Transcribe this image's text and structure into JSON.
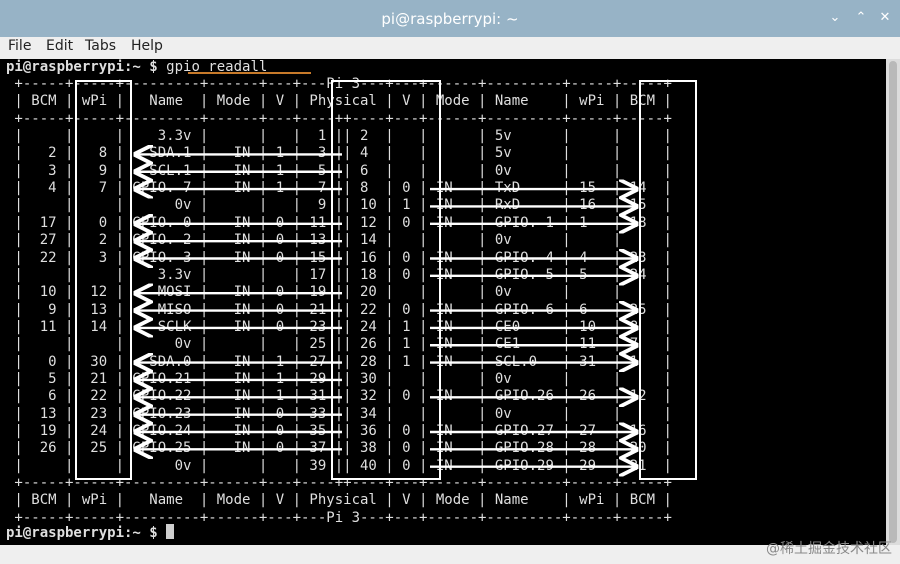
{
  "window": {
    "title": "pi@raspberrypi: ~",
    "minimize": "⌄",
    "maximize": "⌃",
    "close": "✕"
  },
  "menu": [
    "File",
    "Edit",
    "Tabs",
    "Help"
  ],
  "terminal": {
    "prompt_user": "pi@raspberrypi:~ $ ",
    "command": "gpio readall",
    "lines": [
      " +-----+-----+---------+------+---+---Pi 3---+---+------+---------+-----+-----+",
      " | BCM | wPi |   Name  | Mode | V | Physical | V | Mode | Name    | wPi | BCM |",
      " +-----+-----+---------+------+---+----++----+---+------+---------+-----+-----+",
      " |     |     |    3.3v |      |   |  1 || 2  |   |      | 5v      |     |     |",
      " |   2 |   8 |   SDA.1 |   IN | 1 |  3 || 4  |   |      | 5v      |     |     |",
      " |   3 |   9 |   SCL.1 |   IN | 1 |  5 || 6  |   |      | 0v      |     |     |",
      " |   4 |   7 | GPIO. 7 |   IN | 1 |  7 || 8  | 0 | IN   | TxD     | 15  | 14  |",
      " |     |     |      0v |      |   |  9 || 10 | 1 | IN   | RxD     | 16  | 15  |",
      " |  17 |   0 | GPIO. 0 |   IN | 0 | 11 || 12 | 0 | IN   | GPIO. 1 | 1   | 18  |",
      " |  27 |   2 | GPIO. 2 |   IN | 0 | 13 || 14 |   |      | 0v      |     |     |",
      " |  22 |   3 | GPIO. 3 |   IN | 0 | 15 || 16 | 0 | IN   | GPIO. 4 | 4   | 23  |",
      " |     |     |    3.3v |      |   | 17 || 18 | 0 | IN   | GPIO. 5 | 5   | 24  |",
      " |  10 |  12 |    MOSI |   IN | 0 | 19 || 20 |   |      | 0v      |     |     |",
      " |   9 |  13 |    MISO |   IN | 0 | 21 || 22 | 0 | IN   | GPIO. 6 | 6   | 25  |",
      " |  11 |  14 |    SCLK |   IN | 0 | 23 || 24 | 1 | IN   | CE0     | 10  | 8   |",
      " |     |     |      0v |      |   | 25 || 26 | 1 | IN   | CE1     | 11  | 7   |",
      " |   0 |  30 |   SDA.0 |   IN | 1 | 27 || 28 | 1 | IN   | SCL.0   | 31  | 1   |",
      " |   5 |  21 | GPIO.21 |   IN | 1 | 29 || 30 |   |      | 0v      |     |     |",
      " |   6 |  22 | GPIO.22 |   IN | 1 | 31 || 32 | 0 | IN   | GPIO.26 | 26  | 12  |",
      " |  13 |  23 | GPIO.23 |   IN | 0 | 33 || 34 |   |      | 0v      |     |     |",
      " |  19 |  24 | GPIO.24 |   IN | 0 | 35 || 36 | 0 | IN   | GPIO.27 | 27  | 16  |",
      " |  26 |  25 | GPIO.25 |   IN | 0 | 37 || 38 | 0 | IN   | GPIO.28 | 28  | 20  |",
      " |     |     |      0v |      |   | 39 || 40 | 0 | IN   | GPIO.29 | 29  | 21  |",
      " +-----+-----+---------+------+---+----++----+---+------+---------+-----+-----+",
      " | BCM | wPi |   Name  | Mode | V | Physical | V | Mode | Name    | wPi | BCM |",
      " +-----+-----+---------+------+---+---Pi 3---+---+------+---------+-----+-----+"
    ],
    "final_prompt": "pi@raspberrypi:~ $ "
  },
  "watermark": "@稀土掘金技术社区",
  "colors": {
    "titlebar": "#97b3c6",
    "menubar": "#efefef",
    "terminal_bg": "#000000",
    "text": "#dfdfdf",
    "underline": "#c77a2a"
  }
}
